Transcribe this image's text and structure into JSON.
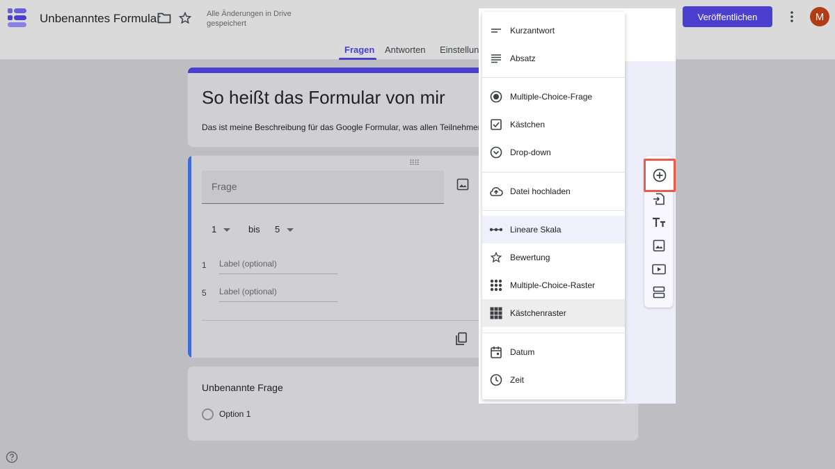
{
  "header": {
    "app_title": "Unbenanntes Formular",
    "save_status": "Alle Änderungen in Drive gespeichert",
    "publish_label": "Veröffentlichen",
    "avatar_initial": "M",
    "icons": [
      "forms-logo-icon",
      "folder-icon",
      "star-icon",
      "link-icon",
      "add-person-icon",
      "more-vert-icon"
    ]
  },
  "tabs": [
    {
      "label": "Fragen",
      "active": true
    },
    {
      "label": "Antworten",
      "active": false
    },
    {
      "label": "Einstellungen",
      "active": false
    }
  ],
  "form": {
    "title": "So heißt das Formular von mir",
    "description": "Das ist meine Beschreibung für das Google Formular, was allen Teilnehmern angezeigt wird."
  },
  "question": {
    "placeholder": "Frage",
    "scale_from": "1",
    "scale_to_label": "bis",
    "scale_to": "5",
    "label_rows": [
      {
        "num": "1",
        "placeholder": "Label (optional)"
      },
      {
        "num": "5",
        "placeholder": "Label (optional)"
      }
    ]
  },
  "unnamed_question": {
    "title": "Unbenannte Frage",
    "option": "Option 1"
  },
  "type_menu": {
    "items": [
      {
        "label": "Kurzantwort",
        "icon": "short-text-icon"
      },
      {
        "label": "Absatz",
        "icon": "paragraph-icon"
      },
      {
        "label": "Multiple-Choice-Frage",
        "icon": "radio-icon"
      },
      {
        "label": "Kästchen",
        "icon": "checkbox-icon"
      },
      {
        "label": "Drop-down",
        "icon": "dropdown-icon"
      },
      {
        "label": "Datei hochladen",
        "icon": "upload-cloud-icon"
      },
      {
        "label": "Lineare Skala",
        "icon": "linear-scale-icon",
        "highlight": "selected"
      },
      {
        "label": "Bewertung",
        "icon": "star-outline-icon"
      },
      {
        "label": "Multiple-Choice-Raster",
        "icon": "dot-grid-icon"
      },
      {
        "label": "Kästchenraster",
        "icon": "box-grid-icon",
        "highlight": "hover"
      },
      {
        "label": "Datum",
        "icon": "calendar-icon"
      },
      {
        "label": "Zeit",
        "icon": "clock-icon"
      }
    ]
  },
  "side_tools": [
    "add-question-icon",
    "import-questions-icon",
    "title-text-icon",
    "image-icon",
    "video-icon",
    "section-icon"
  ],
  "colors": {
    "accent": "#4b3fcf",
    "highlight_box": "#ea5b4c",
    "avatar": "#b23c17",
    "question_bar": "#4169d8"
  }
}
